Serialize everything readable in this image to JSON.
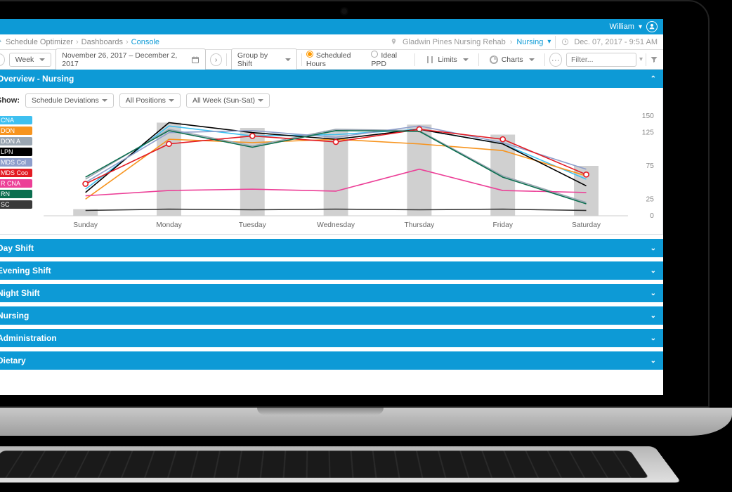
{
  "header": {
    "username": "William"
  },
  "breadcrumb": {
    "items": [
      "Schedule Optimizer",
      "Dashboards",
      "Console"
    ],
    "location": "Gladwin Pines Nursing Rehab",
    "location_link": "Nursing",
    "datetime": "Dec. 07, 2017 - 9:51 AM"
  },
  "toolbar": {
    "period": "Week",
    "range": "November 26, 2017  –  December 2, 2017",
    "group": "Group by Shift",
    "radios": {
      "scheduled": "Scheduled Hours",
      "ideal": "Ideal PPD"
    },
    "limits": "Limits",
    "charts": "Charts",
    "filter_placeholder": "Filter..."
  },
  "overview": {
    "title": "Overview - Nursing",
    "show_label": "Show:",
    "selects": {
      "deviation": "Schedule Deviations",
      "positions": "All Positions",
      "week": "All Week (Sun-Sat)"
    }
  },
  "sections": [
    "Day Shift",
    "Evening Shift",
    "Night Shift",
    "Nursing",
    "Administration",
    "Dietary"
  ],
  "chart_data": {
    "type": "line",
    "categories": [
      "Sunday",
      "Monday",
      "Tuesday",
      "Wednesday",
      "Thursday",
      "Friday",
      "Saturday"
    ],
    "ylim": [
      0,
      150
    ],
    "yticks": [
      0,
      25,
      75,
      125,
      150
    ],
    "bars": [
      10,
      140,
      132,
      128,
      137,
      122,
      75
    ],
    "series": [
      {
        "name": "CNA",
        "color": "#3ec0f0",
        "values": [
          40,
          135,
          120,
          122,
          130,
          108,
          55
        ]
      },
      {
        "name": "DON",
        "color": "#f7941e",
        "values": [
          25,
          115,
          110,
          115,
          108,
          98,
          60
        ]
      },
      {
        "name": "DON A",
        "color": "#9aa6b2",
        "values": [
          55,
          130,
          105,
          130,
          128,
          60,
          20
        ]
      },
      {
        "name": "LPN",
        "color": "#000000",
        "values": [
          35,
          140,
          125,
          115,
          130,
          108,
          45
        ]
      },
      {
        "name": "MDS Col",
        "color": "#8e9ecb",
        "values": [
          50,
          125,
          128,
          118,
          135,
          110,
          70
        ]
      },
      {
        "name": "MDS Coo",
        "color": "#e31b23",
        "values": [
          48,
          108,
          120,
          111,
          130,
          115,
          62
        ]
      },
      {
        "name": "R CNA",
        "color": "#ec3f97",
        "values": [
          30,
          38,
          40,
          37,
          70,
          38,
          35
        ]
      },
      {
        "name": "RN",
        "color": "#0b6e4f",
        "values": [
          58,
          128,
          103,
          128,
          127,
          58,
          18
        ]
      },
      {
        "name": "SC",
        "color": "#3a3a3a",
        "values": [
          8,
          10,
          9,
          10,
          9,
          10,
          8
        ]
      }
    ],
    "highlight_series": 5,
    "highlight_points": [
      0,
      1,
      2,
      3,
      4,
      5,
      6
    ]
  }
}
